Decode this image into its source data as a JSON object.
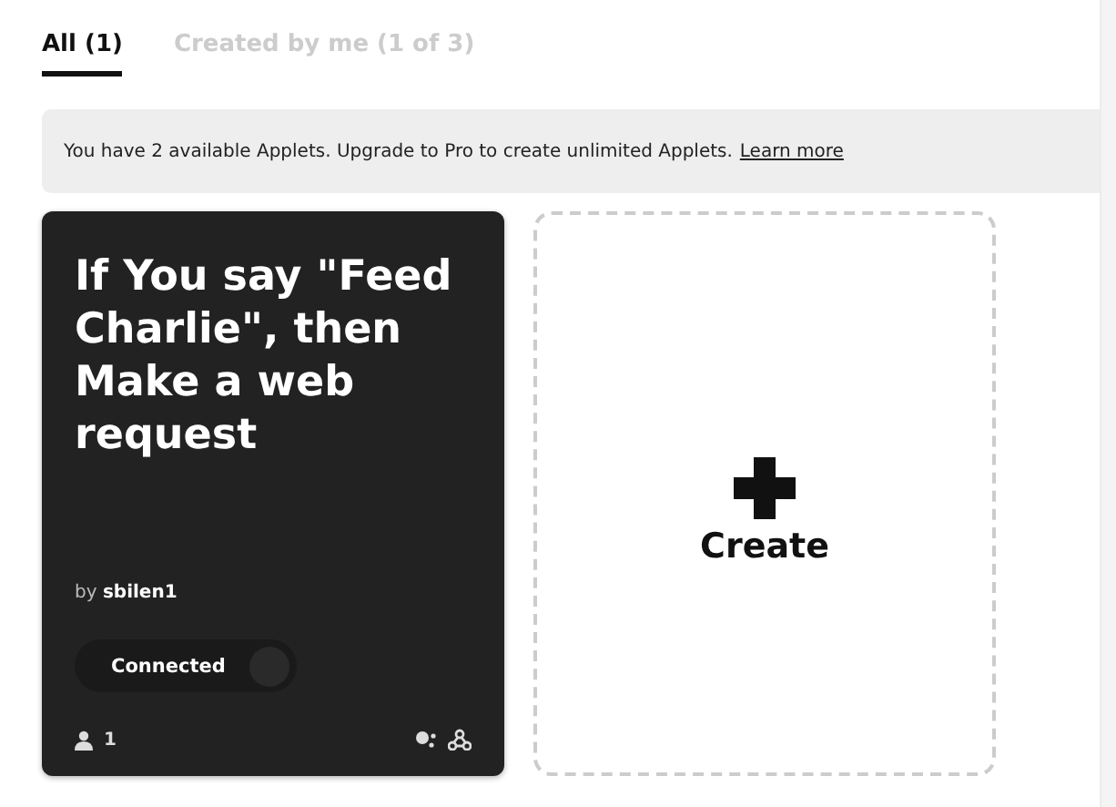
{
  "tabs": [
    {
      "label": "All (1)",
      "selected": true
    },
    {
      "label": "Created by me (1 of 3)",
      "selected": false
    }
  ],
  "banner": {
    "text": "You have 2 available Applets. Upgrade to Pro to create unlimited Applets.",
    "link": "Learn more"
  },
  "applet": {
    "title": "If You say \"Feed Charlie\", then Make a web request",
    "by_label": "by",
    "author": "sbilen1",
    "toggle": {
      "label": "Connected",
      "on": true
    },
    "users": "1"
  },
  "create": {
    "label": "Create"
  }
}
